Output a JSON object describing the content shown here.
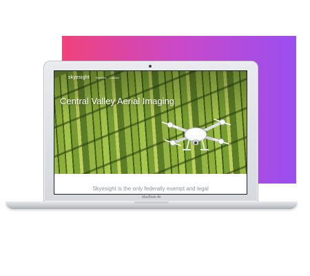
{
  "brand": "skyesight",
  "nav": [
    "Services",
    "Contact"
  ],
  "hero": {
    "title": "Central Valley Aerial Imaging"
  },
  "caption": "Skyesight is the only federally exempt and legal",
  "device": {
    "model_label": "MacBook Air"
  },
  "colors": {
    "gradient_start": "#f0427a",
    "gradient_end": "#9a4ff0"
  },
  "icons": {
    "drone": "quadcopter-drone-icon"
  }
}
